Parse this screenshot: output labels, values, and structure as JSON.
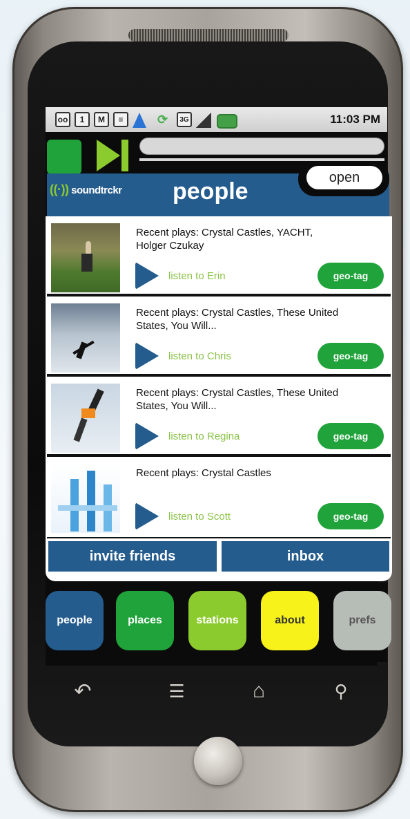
{
  "status_bar": {
    "icons": [
      "voicemail-icon",
      "calendar-icon",
      "gmail-icon",
      "talk-icon",
      "navigation-icon",
      "sync-icon",
      "3g-icon",
      "signal-icon",
      "battery-icon"
    ],
    "calendar_day": "1",
    "network_label": "3G",
    "time": "11:03 PM"
  },
  "player": {
    "open_label": "open",
    "progress": 0
  },
  "header": {
    "logo_text": "soundtrckr",
    "title": "people"
  },
  "people": [
    {
      "recent": "Recent plays: Crystal Castles, YACHT, Holger Czukay",
      "listen": "listen to Erin",
      "geotag": "geo-tag"
    },
    {
      "recent": "Recent plays: Crystal Castles, These United States, You Will...",
      "listen": "listen to Chris",
      "geotag": "geo-tag"
    },
    {
      "recent": "Recent plays: Crystal Castles, These United States, You Will...",
      "listen": "listen to Regina",
      "geotag": "geo-tag"
    },
    {
      "recent": "Recent plays: Crystal Castles",
      "listen": "listen to Scott",
      "geotag": "geo-tag"
    }
  ],
  "actions": {
    "invite": "invite friends",
    "inbox": "inbox"
  },
  "tabs": [
    {
      "label": "people",
      "color": "#255c8e",
      "text_color": "#ffffff"
    },
    {
      "label": "places",
      "color": "#1fa33a",
      "text_color": "#ffffff"
    },
    {
      "label": "stations",
      "color": "#8ccb2d",
      "text_color": "#ffffff"
    },
    {
      "label": "about",
      "color": "#f7f21a",
      "text_color": "#333333"
    },
    {
      "label": "prefs",
      "color": "#b6bcb6",
      "text_color": "#555555"
    }
  ],
  "colors": {
    "brand_blue": "#255c8e",
    "brand_green": "#1fa33a",
    "listen_green": "#8bc34a"
  }
}
